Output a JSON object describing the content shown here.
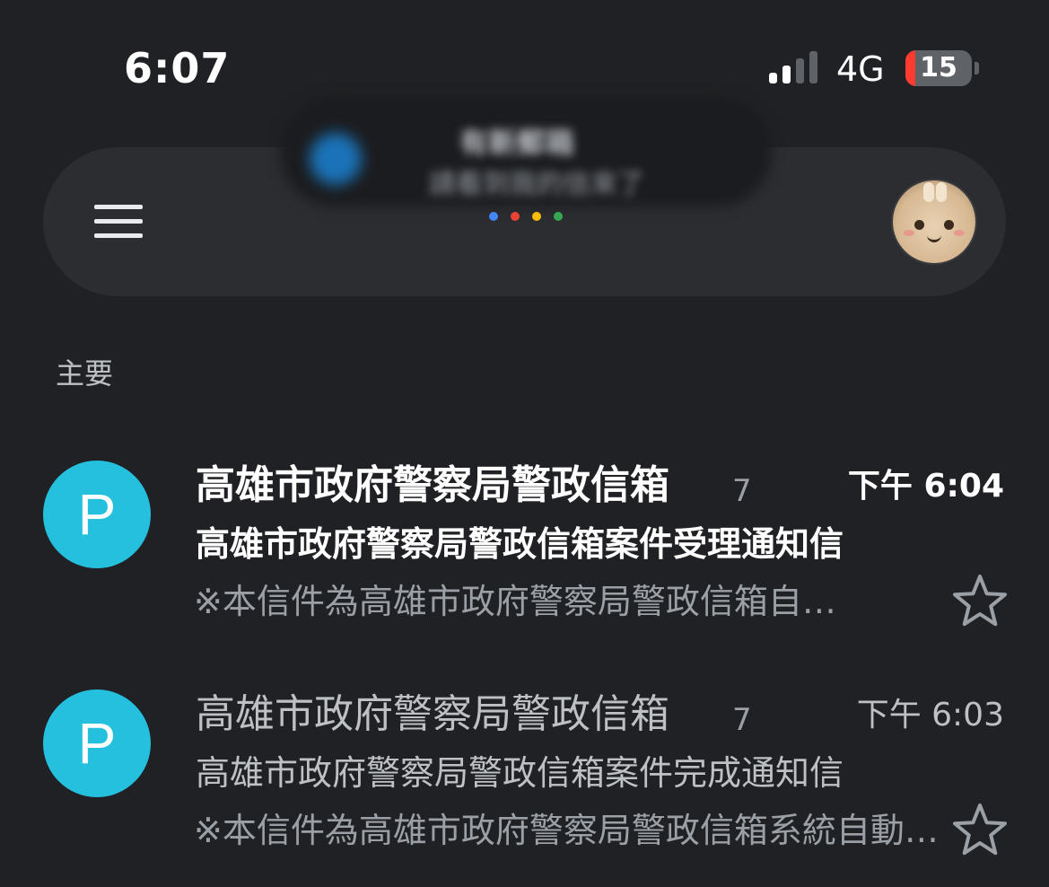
{
  "status_bar": {
    "time": "6:07",
    "network": "4G",
    "battery_level": "15",
    "battery_fraction": 0.15,
    "signal_bars_active": 2,
    "signal_bars_total": 4
  },
  "search_bar": {
    "menu_icon": "hamburger-menu-icon",
    "notification_title": "有新郵箱",
    "notification_subtitle": "請看到我的信來了",
    "avatar_icon": "profile-avatar",
    "dot_colors": [
      "#4285f4",
      "#ea4335",
      "#fbbc04",
      "#34a853"
    ]
  },
  "section": {
    "label": "主要"
  },
  "emails": [
    {
      "avatar_letter": "P",
      "avatar_color": "#26c0df",
      "sender": "高雄市政府警察局警政信箱",
      "count": "7",
      "time": "下午 6:04",
      "subject": "高雄市政府警察局警政信箱案件受理通知信",
      "snippet": "※本信件為高雄市政府警察局警政信箱自…",
      "unread": true,
      "starred": false
    },
    {
      "avatar_letter": "P",
      "avatar_color": "#26c0df",
      "sender": "高雄市政府警察局警政信箱",
      "count": "7",
      "time": "下午 6:03",
      "subject": "高雄市政府警察局警政信箱案件完成通知信",
      "snippet": "※本信件為高雄市政府警察局警政信箱系統自動…",
      "unread": false,
      "starred": false
    }
  ],
  "colors": {
    "background": "#202124",
    "search_bar": "#2c2d31",
    "battery_low": "#ff3b30"
  }
}
